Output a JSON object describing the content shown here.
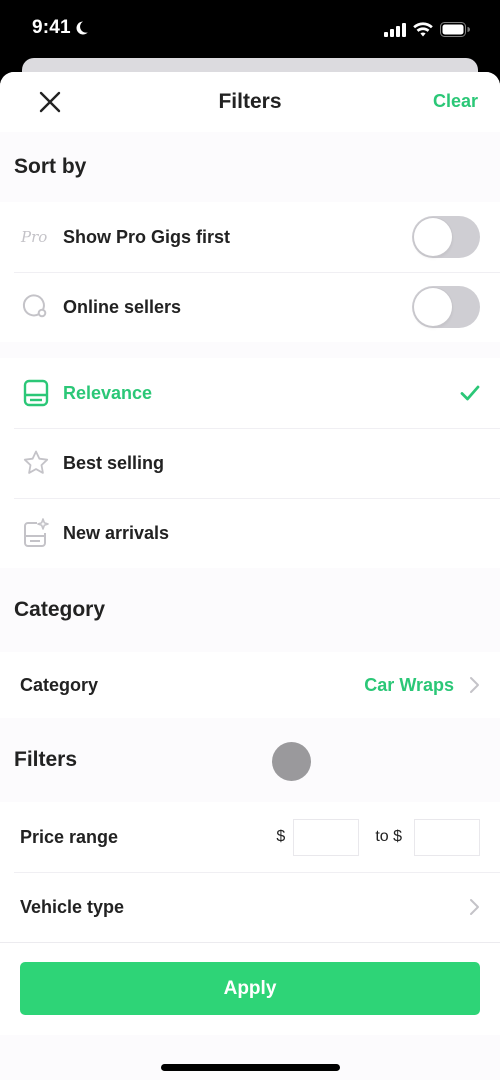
{
  "status_bar": {
    "time": "9:41",
    "focus_icon": "moon-icon",
    "signal_icon": "cellular-signal-icon",
    "wifi_icon": "wifi-icon",
    "battery_icon": "battery-icon"
  },
  "nav": {
    "close_icon": "close-icon",
    "title": "Filters",
    "clear_label": "Clear"
  },
  "colors": {
    "accent": "#2bc777",
    "apply_button": "#2ed477",
    "toggle_off": "#cfced3",
    "icon_gray": "#c4c3c8"
  },
  "sort_by": {
    "title": "Sort by",
    "toggles": [
      {
        "icon": "pro-badge-icon",
        "label": "Show Pro Gigs first",
        "on": false
      },
      {
        "icon": "online-status-icon",
        "label": "Online sellers",
        "on": false
      }
    ],
    "options": [
      {
        "icon": "relevance-icon",
        "label": "Relevance",
        "selected": true,
        "check_icon": "checkmark-icon"
      },
      {
        "icon": "star-icon",
        "label": "Best selling",
        "selected": false
      },
      {
        "icon": "new-arrivals-icon",
        "label": "New arrivals",
        "selected": false
      }
    ]
  },
  "category": {
    "title": "Category",
    "row_label": "Category",
    "value": "Car Wraps",
    "chevron_icon": "chevron-right-icon"
  },
  "filters": {
    "title": "Filters",
    "price_range": {
      "label": "Price range",
      "currency": "$",
      "to_label": "to $",
      "min_value": "",
      "max_value": ""
    },
    "vehicle_type": {
      "label": "Vehicle type",
      "chevron_icon": "chevron-right-icon"
    }
  },
  "footer": {
    "apply_label": "Apply"
  }
}
